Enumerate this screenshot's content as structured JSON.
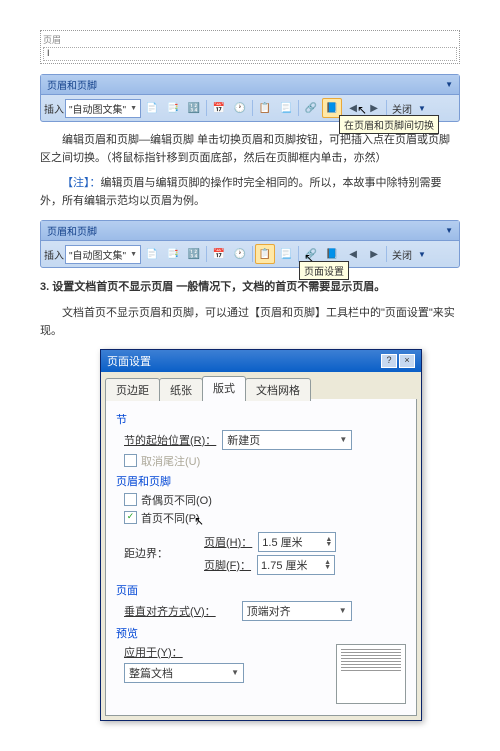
{
  "header_preview": {
    "label": "页眉",
    "cursor": "I"
  },
  "toolbar1": {
    "title": "页眉和页脚",
    "insert_label": "插入",
    "autotext": "\"自动图文集\"",
    "close": "关闭",
    "tooltip": "在页眉和页脚间切换"
  },
  "para1": "编辑页眉和页脚—编辑页脚 单击切换页眉和页脚按钮，可把插入点在页眉或页脚区之间切换。（将鼠标指针移到页面底部，然后在页脚框内单击，亦然）",
  "para2_prefix": "【注】：",
  "para2": "编辑页眉与编辑页脚的操作时完全相同的。所以，本故事中除特别需要外，所有编辑示范均以页眉为例。",
  "toolbar2": {
    "title": "页眉和页脚",
    "insert_label": "插入",
    "autotext": "\"自动图文集\"",
    "close": "关闭",
    "tooltip": "页面设置"
  },
  "section3_title": "3. 设置文档首页不显示页眉 一般情况下，文档的首页不需要显示页眉。",
  "section3_body": "文档首页不显示页眉和页脚，可以通过【页眉和页脚】工具栏中的\"页面设置\"来实现。",
  "dialog": {
    "title": "页面设置",
    "tabs": [
      "页边距",
      "纸张",
      "版式",
      "文档网格"
    ],
    "active_tab": 2,
    "group_section": "节",
    "section_start_label": "节的起始位置(R)：",
    "section_start_value": "新建页",
    "suppress_endnotes": "取消尾注(U)",
    "group_hf": "页眉和页脚",
    "odd_even": "奇偶页不同(O)",
    "first_page": "首页不同(P)",
    "margin_label": "距边界：",
    "header_label": "页眉(H)：",
    "header_value": "1.5 厘米",
    "footer_label": "页脚(F)：",
    "footer_value": "1.75 厘米",
    "group_page": "页面",
    "valign_label": "垂直对齐方式(V)：",
    "valign_value": "顶端对齐",
    "group_preview": "预览",
    "apply_label": "应用于(Y)：",
    "apply_value": "整篇文档"
  }
}
